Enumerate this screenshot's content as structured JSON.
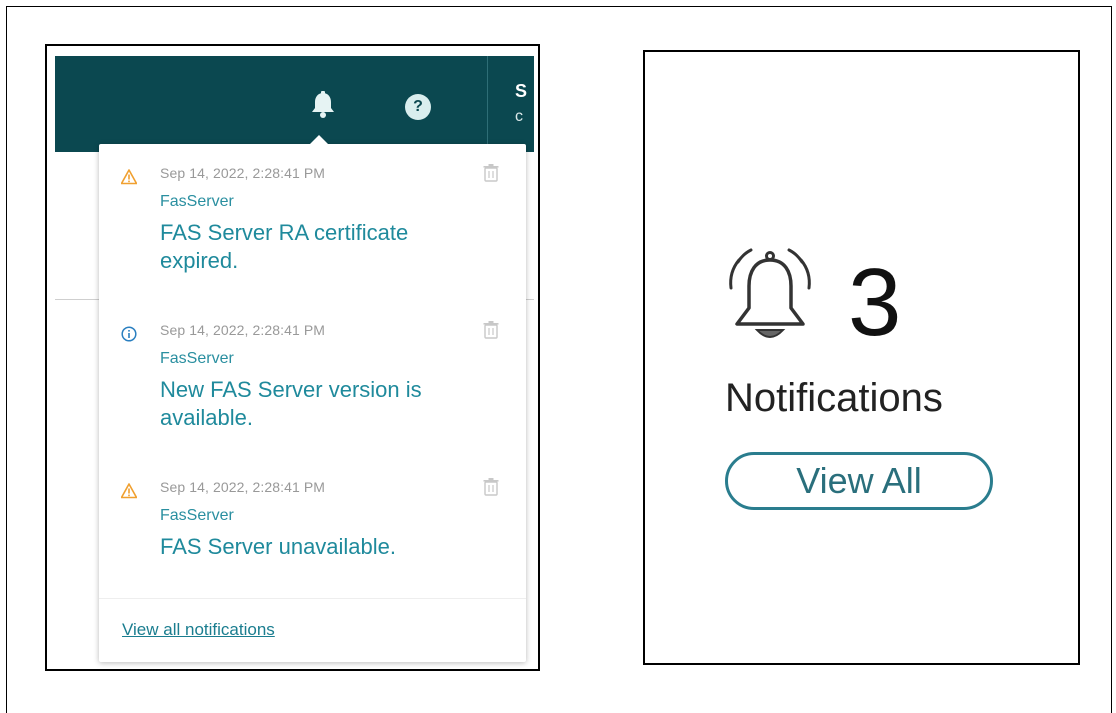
{
  "topbar": {
    "clipped_line1": "S",
    "clipped_line2": "c",
    "help_glyph": "?",
    "bell_icon": "bell-icon",
    "help_icon": "help-circle-icon",
    "bg_color": "#0b4850"
  },
  "notifications": [
    {
      "severity": "warning",
      "severity_icon": "warning-triangle-icon",
      "timestamp": "Sep 14, 2022, 2:28:41 PM",
      "source": "FasServer",
      "message": "FAS Server RA certificate expired."
    },
    {
      "severity": "info",
      "severity_icon": "info-circle-icon",
      "timestamp": "Sep 14, 2022, 2:28:41 PM",
      "source": "FasServer",
      "message": "New FAS Server version is available."
    },
    {
      "severity": "warning",
      "severity_icon": "warning-triangle-icon",
      "timestamp": "Sep 14, 2022, 2:28:41 PM",
      "source": "FasServer",
      "message": "FAS Server unavailable."
    }
  ],
  "dropdown": {
    "view_all_link": "View all notifications"
  },
  "summary": {
    "count": "3",
    "label": "Notifications",
    "button_label": "View All",
    "bell_icon": "ringing-bell-icon"
  },
  "colors": {
    "accent": "#1f8a9c",
    "warning": "#f0a030",
    "info": "#2a7fc0"
  }
}
